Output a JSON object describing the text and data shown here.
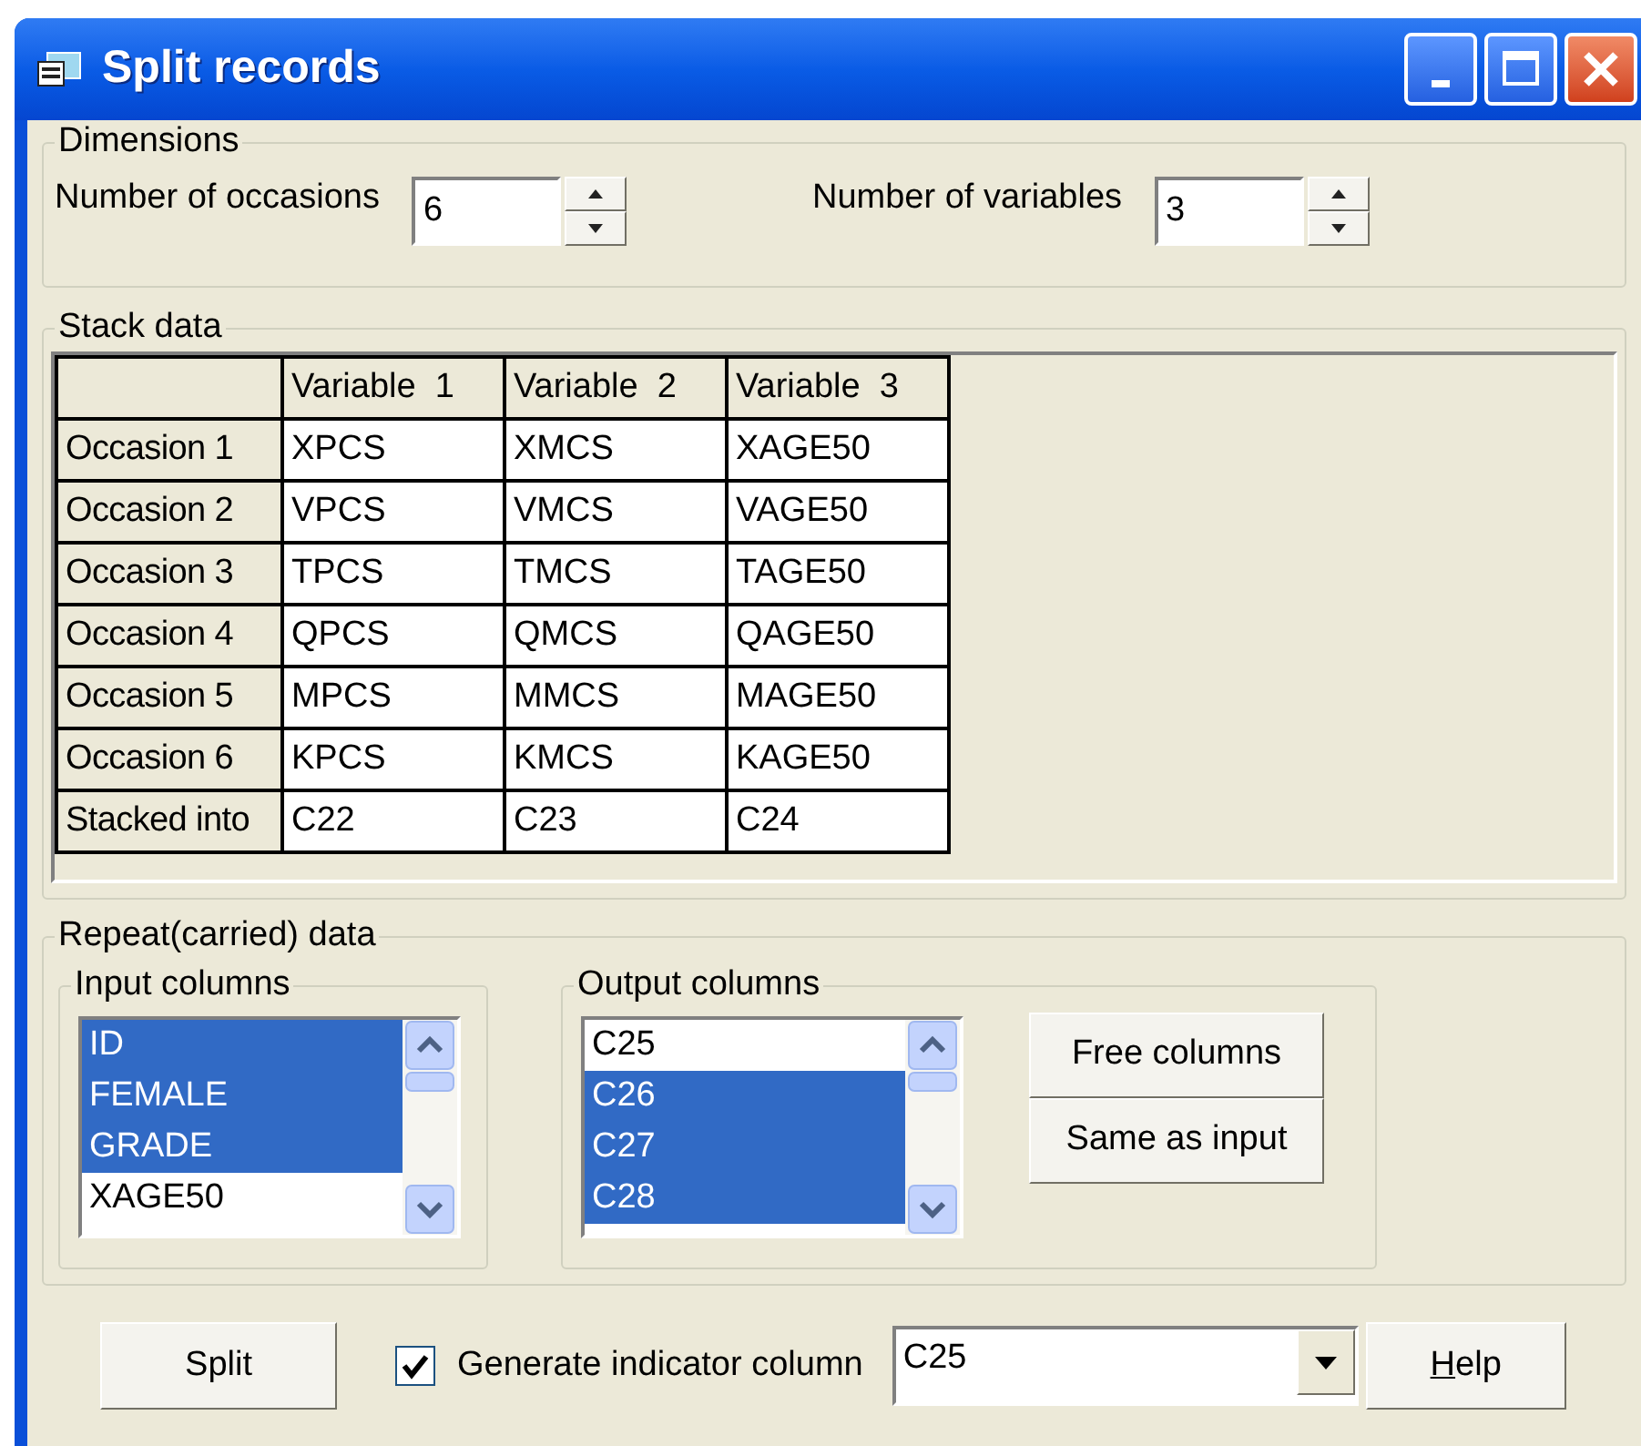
{
  "window": {
    "title": "Split records"
  },
  "dimensions": {
    "label": "Dimensions",
    "fields": [
      {
        "label": "Number of occasions",
        "value": "6"
      },
      {
        "label": "Number of variables",
        "value": "3"
      }
    ]
  },
  "stack_data": {
    "label": "Stack data",
    "columns": [
      "Variable  1",
      "Variable  2",
      "Variable  3"
    ],
    "rows": [
      {
        "header": "Occasion 1",
        "cells": [
          "XPCS",
          "XMCS",
          "XAGE50"
        ]
      },
      {
        "header": "Occasion 2",
        "cells": [
          "VPCS",
          "VMCS",
          "VAGE50"
        ]
      },
      {
        "header": "Occasion 3",
        "cells": [
          "TPCS",
          "TMCS",
          "TAGE50"
        ]
      },
      {
        "header": "Occasion 4",
        "cells": [
          "QPCS",
          "QMCS",
          "QAGE50"
        ]
      },
      {
        "header": "Occasion 5",
        "cells": [
          "MPCS",
          "MMCS",
          "MAGE50"
        ]
      },
      {
        "header": "Occasion 6",
        "cells": [
          "KPCS",
          "KMCS",
          "KAGE50"
        ]
      },
      {
        "header": "Stacked into",
        "cells": [
          "C22",
          "C23",
          "C24"
        ]
      }
    ]
  },
  "repeat_data": {
    "label": "Repeat(carried) data",
    "input_columns": {
      "label": "Input columns",
      "items": [
        {
          "label": "ID",
          "selected": true
        },
        {
          "label": "FEMALE",
          "selected": true
        },
        {
          "label": "GRADE",
          "selected": true
        },
        {
          "label": "XAGE50",
          "selected": false
        }
      ]
    },
    "output_columns": {
      "label": "Output columns",
      "items": [
        {
          "label": "C25",
          "selected": false
        },
        {
          "label": "C26",
          "selected": true
        },
        {
          "label": "C27",
          "selected": true
        },
        {
          "label": "C28",
          "selected": true
        }
      ]
    },
    "buttons": [
      "Free columns",
      "Same as input"
    ]
  },
  "footer": {
    "split_button": "Split",
    "indicator": {
      "label": "Generate indicator column",
      "checked": true
    },
    "indicator_column": "C25",
    "help_button": "Help"
  }
}
